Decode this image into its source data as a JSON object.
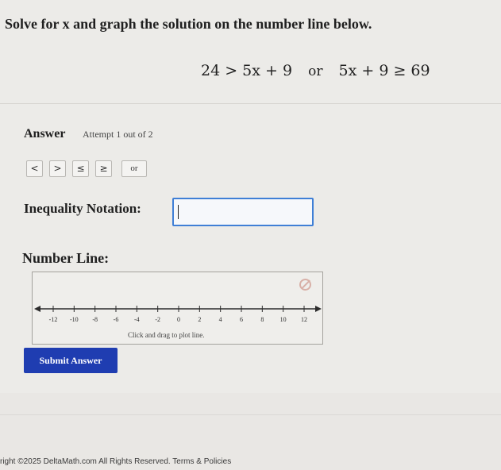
{
  "question": {
    "text": "Solve for x and graph the solution on the number line below.",
    "equation_left": "24 > 5x + 9",
    "equation_connector": "or",
    "equation_right": "5x + 9 ≥ 69"
  },
  "answer": {
    "label": "Answer",
    "attempt": "Attempt 1 out of 2"
  },
  "symbols": [
    "<",
    ">",
    "≤",
    "≥",
    "or"
  ],
  "inequality": {
    "label": "Inequality Notation:",
    "value": ""
  },
  "number_line": {
    "label": "Number Line:",
    "ticks": [
      "-12",
      "-10",
      "-8",
      "-6",
      "-4",
      "-2",
      "0",
      "2",
      "4",
      "6",
      "8",
      "10",
      "12"
    ],
    "hint": "Click and drag to plot line."
  },
  "submit_label": "Submit Answer",
  "footer": "right ©2025 DeltaMath.com All Rights Reserved. Terms & Policies",
  "colors": {
    "accent": "#1f3db1",
    "input_border": "#3f7fd6"
  }
}
